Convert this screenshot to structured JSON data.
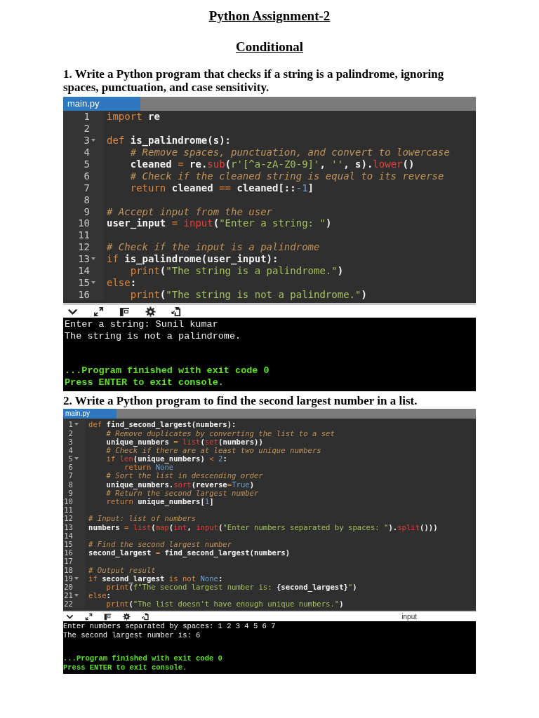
{
  "title": "Python Assignment-2",
  "subtitle": "Conditional",
  "sections": [
    {
      "question": "1. Write a Python program that checks if a string is a palindrome, ignoring spaces, punctuation, and case sensitivity.",
      "editor": {
        "tab": "main.py",
        "lines": [
          {
            "number": "1",
            "foldable": false,
            "tokens": [
              {
                "kind": "keyword",
                "text": "import"
              },
              {
                "kind": "plain",
                "text": " re"
              }
            ]
          },
          {
            "number": "2",
            "foldable": false
          },
          {
            "number": "3",
            "foldable": true,
            "tokens": [
              {
                "kind": "keyword",
                "text": "def"
              },
              {
                "kind": "plain",
                "text": " is_palindrome(s):"
              }
            ]
          },
          {
            "number": "4",
            "foldable": false,
            "tokens": [
              {
                "kind": "comment",
                "text": "    # Remove spaces, punctuation, and convert to lowercase"
              }
            ]
          },
          {
            "number": "5",
            "foldable": false,
            "tokens": [
              {
                "kind": "plain",
                "text": "    cleaned "
              },
              {
                "kind": "operator",
                "text": "="
              },
              {
                "kind": "plain",
                "text": " re."
              },
              {
                "kind": "builtin",
                "text": "sub"
              },
              {
                "kind": "plain",
                "text": "("
              },
              {
                "kind": "string",
                "text": "r'[^a-zA-Z0-9]'"
              },
              {
                "kind": "plain",
                "text": ", "
              },
              {
                "kind": "string",
                "text": "''"
              },
              {
                "kind": "plain",
                "text": ", s)."
              },
              {
                "kind": "builtin",
                "text": "lower"
              },
              {
                "kind": "plain",
                "text": "()"
              }
            ]
          },
          {
            "number": "6",
            "foldable": false,
            "tokens": [
              {
                "kind": "comment",
                "text": "    # Check if the cleaned string is equal to its reverse"
              }
            ]
          },
          {
            "number": "7",
            "foldable": false,
            "tokens": [
              {
                "kind": "keyword",
                "text": "    return"
              },
              {
                "kind": "plain",
                "text": " cleaned "
              },
              {
                "kind": "operator",
                "text": "=="
              },
              {
                "kind": "plain",
                "text": " cleaned[::"
              },
              {
                "kind": "number",
                "text": "-1"
              },
              {
                "kind": "plain",
                "text": "]"
              }
            ]
          },
          {
            "number": "8",
            "foldable": false
          },
          {
            "number": "9",
            "foldable": false,
            "tokens": [
              {
                "kind": "comment",
                "text": "# Accept input from the user"
              }
            ]
          },
          {
            "number": "10",
            "foldable": false,
            "tokens": [
              {
                "kind": "plain",
                "text": "user_input "
              },
              {
                "kind": "operator",
                "text": "= "
              },
              {
                "kind": "builtin",
                "text": "input"
              },
              {
                "kind": "plain",
                "text": "("
              },
              {
                "kind": "string",
                "text": "\"Enter a string: \""
              },
              {
                "kind": "plain",
                "text": ")"
              }
            ]
          },
          {
            "number": "11",
            "foldable": false
          },
          {
            "number": "12",
            "foldable": false,
            "tokens": [
              {
                "kind": "comment",
                "text": "# Check if the input is a palindrome"
              }
            ]
          },
          {
            "number": "13",
            "foldable": true,
            "tokens": [
              {
                "kind": "keyword",
                "text": "if"
              },
              {
                "kind": "plain",
                "text": " is_palindrome(user_input):"
              }
            ]
          },
          {
            "number": "14",
            "foldable": false,
            "tokens": [
              {
                "kind": "keyword",
                "text": "    print"
              },
              {
                "kind": "plain",
                "text": "("
              },
              {
                "kind": "string",
                "text": "\"The string is a palindrome.\""
              },
              {
                "kind": "plain",
                "text": ")"
              }
            ]
          },
          {
            "number": "15",
            "foldable": true,
            "tokens": [
              {
                "kind": "keyword",
                "text": "else"
              },
              {
                "kind": "plain",
                "text": ":"
              }
            ]
          },
          {
            "number": "16",
            "foldable": false,
            "tokens": [
              {
                "kind": "keyword",
                "text": "    print"
              },
              {
                "kind": "plain",
                "text": "("
              },
              {
                "kind": "string",
                "text": "\"The string is not a palindrome.\""
              },
              {
                "kind": "plain",
                "text": ")"
              }
            ]
          }
        ]
      },
      "console": {
        "output": [
          "Enter a string: Sunil kumar",
          "The string is not a palindrome."
        ],
        "status": [
          "...Program finished with exit code 0",
          "Press ENTER to exit console."
        ]
      }
    },
    {
      "question": "2. Write a Python program to find the second largest number in a list.",
      "editor": {
        "tab": "main.py",
        "lines": [
          {
            "number": "1",
            "foldable": true,
            "tokens": [
              {
                "kind": "keyword",
                "text": "def"
              },
              {
                "kind": "plain",
                "text": " find_second_largest(numbers):"
              }
            ]
          },
          {
            "number": "2",
            "foldable": false,
            "tokens": [
              {
                "kind": "comment",
                "text": "    # Remove duplicates by converting the list to a set"
              }
            ]
          },
          {
            "number": "3",
            "foldable": false,
            "tokens": [
              {
                "kind": "plain",
                "text": "    unique_numbers "
              },
              {
                "kind": "operator",
                "text": "= "
              },
              {
                "kind": "builtin",
                "text": "list"
              },
              {
                "kind": "plain",
                "text": "("
              },
              {
                "kind": "builtin",
                "text": "set"
              },
              {
                "kind": "plain",
                "text": "(numbers))"
              }
            ]
          },
          {
            "number": "4",
            "foldable": false,
            "tokens": [
              {
                "kind": "comment",
                "text": "    # Check if there are at least two unique numbers"
              }
            ]
          },
          {
            "number": "5",
            "foldable": true,
            "tokens": [
              {
                "kind": "keyword",
                "text": "    if "
              },
              {
                "kind": "builtin",
                "text": "len"
              },
              {
                "kind": "plain",
                "text": "(unique_numbers) "
              },
              {
                "kind": "operator",
                "text": "< "
              },
              {
                "kind": "number",
                "text": "2"
              },
              {
                "kind": "plain",
                "text": ":"
              }
            ]
          },
          {
            "number": "6",
            "foldable": false,
            "tokens": [
              {
                "kind": "keyword",
                "text": "        return "
              },
              {
                "kind": "number",
                "text": "None"
              }
            ]
          },
          {
            "number": "7",
            "foldable": false,
            "tokens": [
              {
                "kind": "comment",
                "text": "    # Sort the list in descending order"
              }
            ]
          },
          {
            "number": "8",
            "foldable": false,
            "tokens": [
              {
                "kind": "plain",
                "text": "    unique_numbers."
              },
              {
                "kind": "builtin",
                "text": "sort"
              },
              {
                "kind": "plain",
                "text": "(reverse"
              },
              {
                "kind": "operator",
                "text": "="
              },
              {
                "kind": "number",
                "text": "True"
              },
              {
                "kind": "plain",
                "text": ")"
              }
            ]
          },
          {
            "number": "9",
            "foldable": false,
            "tokens": [
              {
                "kind": "comment",
                "text": "    # Return the second largest number"
              }
            ]
          },
          {
            "number": "10",
            "foldable": false,
            "tokens": [
              {
                "kind": "keyword",
                "text": "    return"
              },
              {
                "kind": "plain",
                "text": " unique_numbers["
              },
              {
                "kind": "number",
                "text": "1"
              },
              {
                "kind": "plain",
                "text": "]"
              }
            ]
          },
          {
            "number": "11",
            "foldable": false
          },
          {
            "number": "12",
            "foldable": false,
            "tokens": [
              {
                "kind": "comment",
                "text": "# Input: list of numbers"
              }
            ]
          },
          {
            "number": "13",
            "foldable": false,
            "tokens": [
              {
                "kind": "plain",
                "text": "numbers "
              },
              {
                "kind": "operator",
                "text": "= "
              },
              {
                "kind": "builtin",
                "text": "list"
              },
              {
                "kind": "plain",
                "text": "("
              },
              {
                "kind": "builtin",
                "text": "map"
              },
              {
                "kind": "plain",
                "text": "("
              },
              {
                "kind": "builtin",
                "text": "int"
              },
              {
                "kind": "plain",
                "text": ", "
              },
              {
                "kind": "builtin",
                "text": "input"
              },
              {
                "kind": "plain",
                "text": "("
              },
              {
                "kind": "string",
                "text": "\"Enter numbers separated by spaces: \""
              },
              {
                "kind": "plain",
                "text": ")."
              },
              {
                "kind": "builtin",
                "text": "split"
              },
              {
                "kind": "plain",
                "text": "()))"
              }
            ]
          },
          {
            "number": "14",
            "foldable": false
          },
          {
            "number": "15",
            "foldable": false,
            "tokens": [
              {
                "kind": "comment",
                "text": "# Find the second largest number"
              }
            ]
          },
          {
            "number": "16",
            "foldable": false,
            "tokens": [
              {
                "kind": "plain",
                "text": "second_largest "
              },
              {
                "kind": "operator",
                "text": "="
              },
              {
                "kind": "plain",
                "text": " find_second_largest(numbers)"
              }
            ]
          },
          {
            "number": "17",
            "foldable": false
          },
          {
            "number": "18",
            "foldable": false,
            "tokens": [
              {
                "kind": "comment",
                "text": "# Output result"
              }
            ]
          },
          {
            "number": "19",
            "foldable": true,
            "tokens": [
              {
                "kind": "keyword",
                "text": "if"
              },
              {
                "kind": "plain",
                "text": " second_largest "
              },
              {
                "kind": "keyword",
                "text": "is not "
              },
              {
                "kind": "number",
                "text": "None"
              },
              {
                "kind": "plain",
                "text": ":"
              }
            ]
          },
          {
            "number": "20",
            "foldable": false,
            "tokens": [
              {
                "kind": "keyword",
                "text": "    print"
              },
              {
                "kind": "plain",
                "text": "("
              },
              {
                "kind": "string",
                "text": "f\"The second largest number is: "
              },
              {
                "kind": "plain",
                "text": "{second_largest}"
              },
              {
                "kind": "string",
                "text": "\""
              },
              {
                "kind": "plain",
                "text": ")"
              }
            ]
          },
          {
            "number": "21",
            "foldable": true,
            "tokens": [
              {
                "kind": "keyword",
                "text": "else"
              },
              {
                "kind": "plain",
                "text": ":"
              }
            ]
          },
          {
            "number": "22",
            "foldable": false,
            "tokens": [
              {
                "kind": "keyword",
                "text": "    print"
              },
              {
                "kind": "plain",
                "text": "("
              },
              {
                "kind": "string",
                "text": "\"The list doesn't have enough unique numbers.\""
              },
              {
                "kind": "plain",
                "text": ")"
              }
            ]
          }
        ]
      },
      "toolbar_label": "input",
      "console": {
        "output": [
          "Enter numbers separated by spaces: 1 2 3 4 5 6 7",
          "The second largest number is: 6"
        ],
        "status": [
          "...Program finished with exit code 0",
          "Press ENTER to exit console."
        ]
      }
    }
  ]
}
